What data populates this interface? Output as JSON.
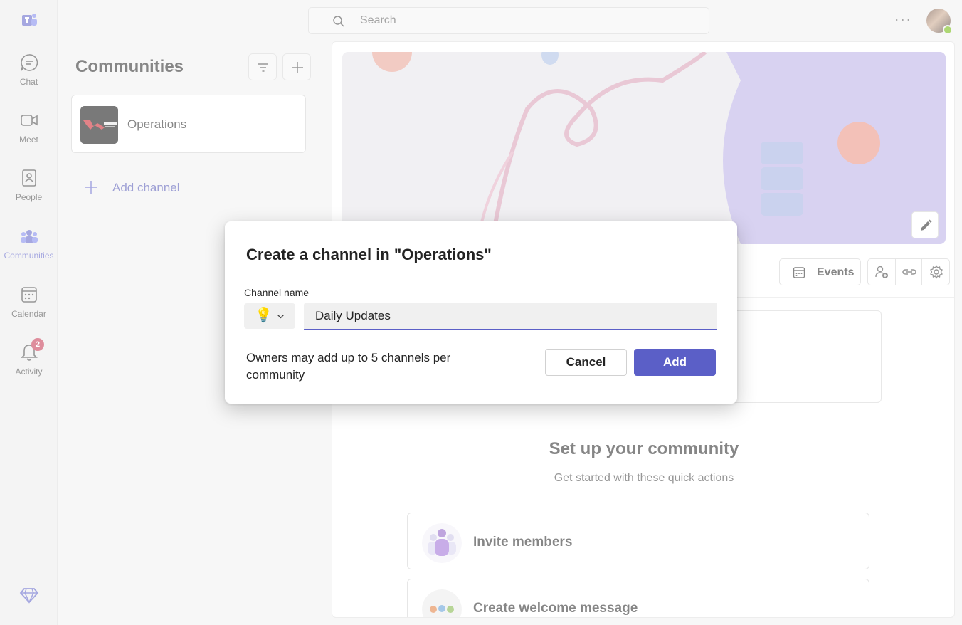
{
  "app": {
    "logo_icon": "teams-logo-icon",
    "accent_color": "#5b5fc7"
  },
  "rail": {
    "items": [
      {
        "label": "Chat",
        "icon": "chat-icon"
      },
      {
        "label": "Meet",
        "icon": "video-camera-icon"
      },
      {
        "label": "People",
        "icon": "contact-book-icon"
      },
      {
        "label": "Communities",
        "icon": "communities-icon",
        "active": true
      },
      {
        "label": "Calendar",
        "icon": "calendar-icon"
      },
      {
        "label": "Activity",
        "icon": "bell-icon",
        "badge": "2"
      }
    ],
    "premium_icon": "diamond-icon"
  },
  "topbar": {
    "search_placeholder": "Search",
    "more_icon": "more-horizontal-icon",
    "avatar_status": "available"
  },
  "communities_panel": {
    "title": "Communities",
    "filter_icon": "filter-icon",
    "new_icon": "plus-icon",
    "communities": [
      {
        "name": "Operations",
        "thumb_icon": "community-logo-thumbnail"
      }
    ],
    "add_channel_label": "Add channel"
  },
  "main": {
    "events_label": "Events",
    "setup_title": "Set up your community",
    "setup_subtitle": "Get started with these quick actions",
    "actions": [
      {
        "label": "Invite members",
        "icon": "invite-members-icon"
      },
      {
        "label": "Create welcome message",
        "icon": "welcome-message-icon"
      }
    ]
  },
  "dialog": {
    "title": "Create a channel in \"Operations\"",
    "field_label": "Channel name",
    "emoji": "💡",
    "channel_name_value": "Daily Updates",
    "note": "Owners may add up to 5 channels per community",
    "cancel_label": "Cancel",
    "add_label": "Add"
  }
}
